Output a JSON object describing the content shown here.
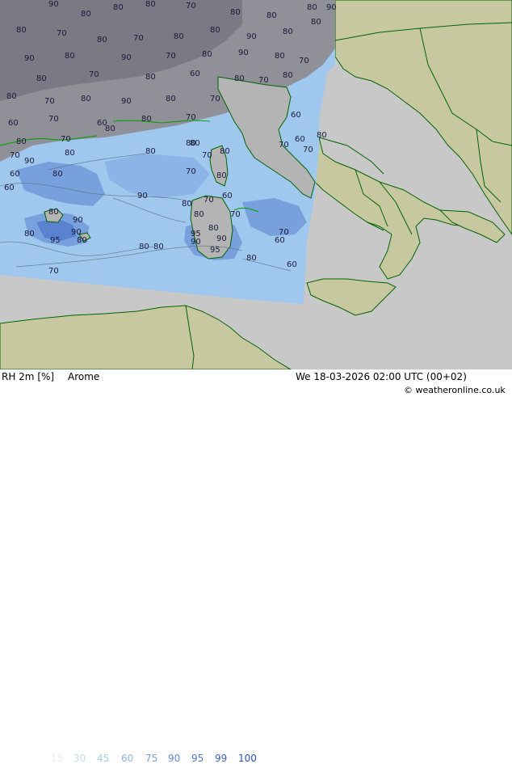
{
  "header": {
    "variable": "RH 2m [%]",
    "model": "Arome",
    "valid_time": "We 18-03-2026 02:00 UTC (00+02)",
    "credit": "© weatheronline.co.uk"
  },
  "legend": {
    "levels": [
      "15",
      "30",
      "45",
      "60",
      "75",
      "90",
      "95",
      "99",
      "100"
    ],
    "colors": [
      "#e6f0fa",
      "#c8dcf0",
      "#a8c8e8",
      "#8cb4e6",
      "#78a0dc",
      "#648ad2",
      "#5078c8",
      "#3c64be",
      "#2850b4"
    ]
  },
  "map_colors": {
    "sea_outside_domain": "#c8c8c8",
    "land": "#c8c8a0",
    "border": "#006400",
    "rh_90": "#a0c8ee",
    "rh_95": "#78a0dc",
    "rh_99": "#5a82d0",
    "cloud": "#909098",
    "overcast": "#7a7a84"
  },
  "contour_labels": {
    "north_cluster": [
      "90",
      "80",
      "80",
      "80",
      "70",
      "80",
      "80",
      "80",
      "90",
      "80",
      "70",
      "80",
      "70",
      "80",
      "80",
      "90",
      "80",
      "80",
      "90",
      "80",
      "90",
      "70",
      "80",
      "90",
      "80",
      "70",
      "80",
      "70",
      "80",
      "60",
      "80",
      "70",
      "80",
      "90",
      "80",
      "70",
      "60",
      "70",
      "80",
      "70",
      "80",
      "70",
      "70",
      "70",
      "80",
      "60",
      "60"
    ],
    "west_cluster": [
      "80",
      "70",
      "80",
      "90",
      "80",
      "70",
      "60",
      "70",
      "60",
      "80",
      "70",
      "80",
      "70",
      "80",
      "70",
      "80",
      "90",
      "60",
      "80",
      "60",
      "80",
      "60",
      "80",
      "70",
      "80",
      "90",
      "80",
      "70",
      "80",
      "80",
      "70",
      "90",
      "90",
      "60",
      "90",
      "90"
    ],
    "sardinia": [
      "80",
      "70",
      "80",
      "70",
      "60",
      "70",
      "80",
      "70",
      "80",
      "80",
      "90",
      "80",
      "95",
      "90",
      "90",
      "80",
      "90",
      "95",
      "80"
    ],
    "corsica": [
      "80",
      "70",
      "80",
      "60"
    ],
    "italy_west": [
      "70",
      "60",
      "70",
      "60",
      "80",
      "80",
      "60",
      "70"
    ],
    "open_sea": [
      "80",
      "90",
      "90",
      "80",
      "80",
      "70",
      "80",
      "80",
      "60",
      "70",
      "95",
      "90",
      "80",
      "80",
      "90",
      "70",
      "90",
      "80"
    ]
  }
}
